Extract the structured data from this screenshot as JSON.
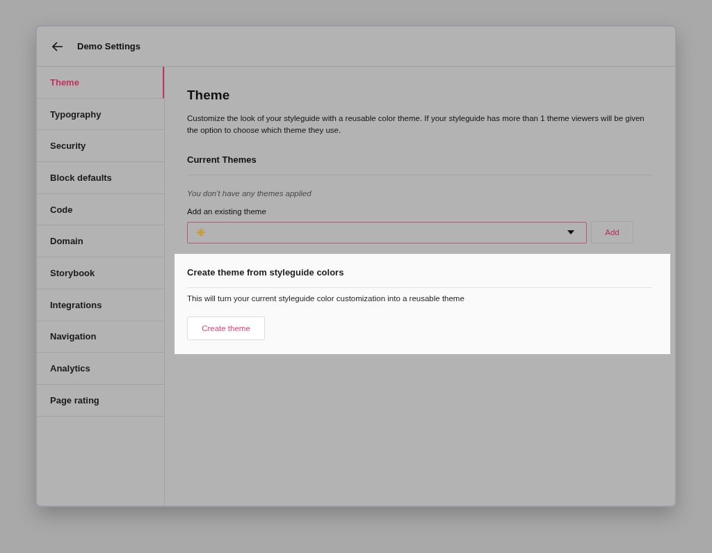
{
  "window": {
    "title": "Demo Settings"
  },
  "sidebar": {
    "items": [
      {
        "label": "Theme",
        "selected": true
      },
      {
        "label": "Typography",
        "selected": false
      },
      {
        "label": "Security",
        "selected": false
      },
      {
        "label": "Block defaults",
        "selected": false
      },
      {
        "label": "Code",
        "selected": false
      },
      {
        "label": "Domain",
        "selected": false
      },
      {
        "label": "Storybook",
        "selected": false
      },
      {
        "label": "Integrations",
        "selected": false
      },
      {
        "label": "Navigation",
        "selected": false
      },
      {
        "label": "Analytics",
        "selected": false
      },
      {
        "label": "Page rating",
        "selected": false
      }
    ]
  },
  "content": {
    "title": "Theme",
    "description": "Customize the look of your styleguide with a reusable color theme. If your styleguide has more than 1 theme viewers will be given the option to choose which theme they use.",
    "current_themes": {
      "heading": "Current Themes",
      "empty_message": "You don't have any themes applied"
    },
    "add_theme": {
      "label": "Add an existing theme",
      "button": "Add"
    },
    "create_panel": {
      "heading": "Create theme from styleguide colors",
      "description": "This will turn your current styleguide color customization into a reusable theme",
      "button": "Create theme"
    }
  }
}
